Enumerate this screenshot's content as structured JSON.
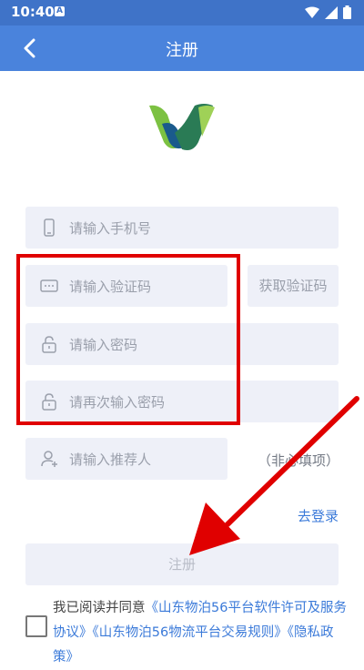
{
  "status_bar": {
    "time": "10:40",
    "notification_letter": "A"
  },
  "app_bar": {
    "title": "注册"
  },
  "form": {
    "phone_placeholder": "请输入手机号",
    "code_placeholder": "请输入验证码",
    "get_code_label": "获取验证码",
    "password_placeholder": "请输入密码",
    "confirm_password_placeholder": "请再次输入密码",
    "referrer_placeholder": "请输入推荐人",
    "referrer_optional": "（非必填项）",
    "login_link": "去登录",
    "register_button": "注册"
  },
  "agreement": {
    "prefix": "我已阅读并同意",
    "link1": "《山东物泊56平台软件许可及服务协议》",
    "link2": "《山东物泊56物流平台交易规则》",
    "link3": "《隐私政策》"
  },
  "colors": {
    "accent": "#4a83dc",
    "status_bar": "#3f73c8",
    "field_bg": "#eef0f8",
    "link": "#3b7ad9",
    "annotation": "#e00000"
  },
  "icons": [
    "back-arrow-icon",
    "wifi-icon",
    "signal-icon",
    "battery-icon",
    "phone-icon",
    "message-icon",
    "lock-icon",
    "user-icon"
  ]
}
